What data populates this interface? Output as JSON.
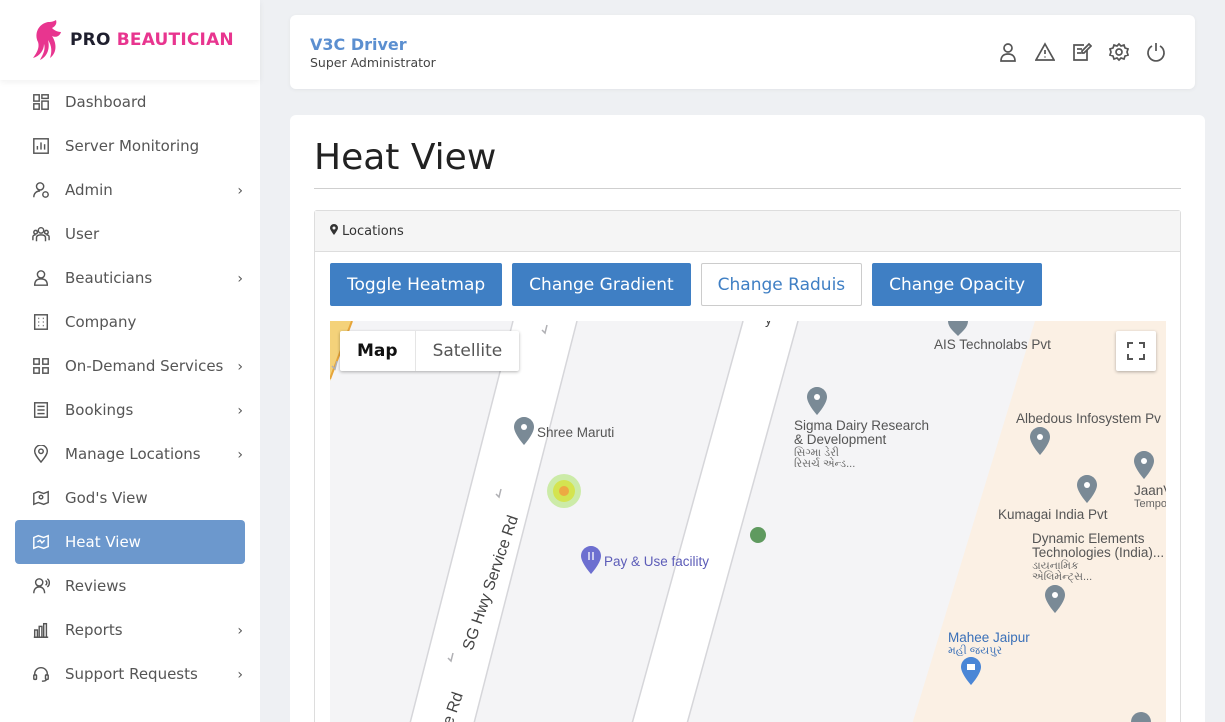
{
  "brand": {
    "pro": "PRO ",
    "name": "BEAUTICIAN"
  },
  "sidebar": {
    "items": [
      {
        "label": "Dashboard",
        "icon": "dashboard-icon",
        "chevron": false
      },
      {
        "label": "Server Monitoring",
        "icon": "chart-icon",
        "chevron": false
      },
      {
        "label": "Admin",
        "icon": "admin-icon",
        "chevron": true
      },
      {
        "label": "User",
        "icon": "users-icon",
        "chevron": false
      },
      {
        "label": "Beauticians",
        "icon": "person-icon",
        "chevron": true
      },
      {
        "label": "Company",
        "icon": "building-icon",
        "chevron": false
      },
      {
        "label": "On-Demand Services",
        "icon": "grid-icon",
        "chevron": true
      },
      {
        "label": "Bookings",
        "icon": "list-icon",
        "chevron": true
      },
      {
        "label": "Manage Locations",
        "icon": "location-icon",
        "chevron": true
      },
      {
        "label": "God's View",
        "icon": "map-pin-icon",
        "chevron": false
      },
      {
        "label": "Heat View",
        "icon": "heatmap-icon",
        "chevron": false,
        "active": true
      },
      {
        "label": "Reviews",
        "icon": "review-icon",
        "chevron": false
      },
      {
        "label": "Reports",
        "icon": "bar-chart-icon",
        "chevron": true
      },
      {
        "label": "Support Requests",
        "icon": "headset-icon",
        "chevron": true
      }
    ],
    "chevron_glyph": "›"
  },
  "header": {
    "user_name": "V3C Driver",
    "user_role": "Super Administrator",
    "icons": [
      "user-icon",
      "warning-icon",
      "edit-icon",
      "settings-icon",
      "power-icon"
    ]
  },
  "main": {
    "title": "Heat View",
    "panel_title": "Locations",
    "buttons": {
      "toggle": "Toggle Heatmap",
      "gradient": "Change Gradient",
      "radius": "Change Raduis",
      "opacity": "Change Opacity"
    }
  },
  "map": {
    "type_map": "Map",
    "type_satellite": "Satellite",
    "labels": {
      "ais": "AIS Technolabs Pvt",
      "sigma1": "Sigma Dairy Research",
      "sigma2": "& Development",
      "sigma3": "સિગ્મા ડેરી",
      "sigma4": "રિસર્ચ એન્ડ...",
      "shree": "Shree Maruti",
      "albedous": "Albedous Infosystem Pv",
      "jaanve": "JaanVe",
      "temporal": "Tempora",
      "kumagai": "Kumagai India Pvt",
      "dynamic1": "Dynamic Elements",
      "dynamic2": "Technologies (India)...",
      "dynamic3": "ડાયનામિક",
      "dynamic4": "એલિમેન્ટ્સ...",
      "payuse": "Pay & Use facility",
      "mahee1": "Mahee Jaipur",
      "mahee2": "મહી જયપુર",
      "sg_road": "SG Hwy Service Rd",
      "ice_rd": "ice Rd"
    }
  },
  "colors": {
    "accent": "#3f7fc4",
    "active_nav": "#6c98cd",
    "brand_pink": "#e8358f"
  }
}
